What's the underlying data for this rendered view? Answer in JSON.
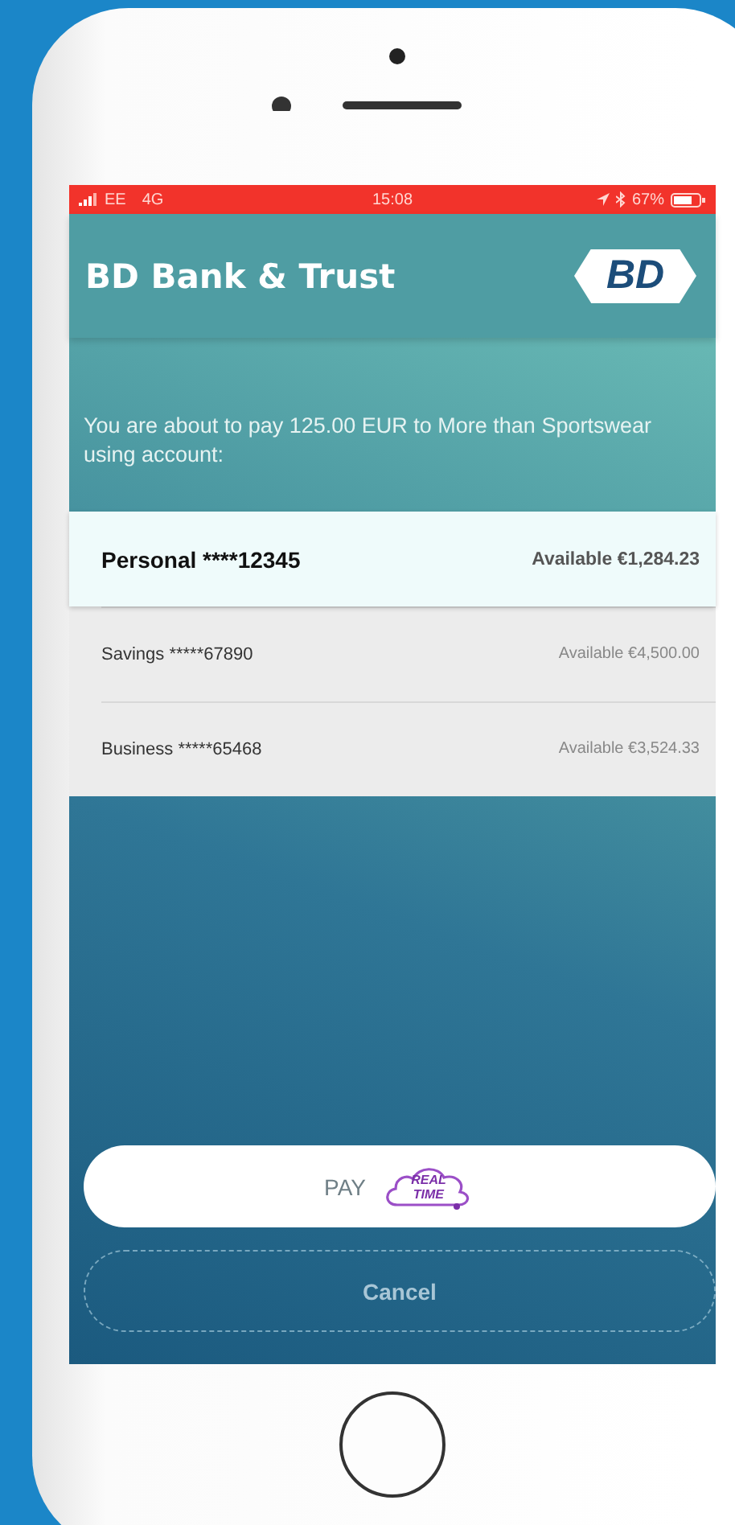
{
  "status_bar": {
    "carrier": "EE",
    "network": "4G",
    "time": "15:08",
    "battery": "67%"
  },
  "header": {
    "title": "BD Bank & Trust",
    "logo": "BD"
  },
  "message": "You are about to pay 125.00 EUR to More than Sportswear using account:",
  "accounts": [
    {
      "name": "Personal ****12345",
      "available": "Available €1,284.23",
      "selected": true
    },
    {
      "name": "Savings *****67890",
      "available": "Available €4,500.00",
      "selected": false
    },
    {
      "name": "Business *****65468",
      "available": "Available €3,524.33",
      "selected": false
    }
  ],
  "pay_button": {
    "label": "PAY",
    "badge": "REAL TIME"
  },
  "cancel_button": {
    "label": "Cancel"
  }
}
